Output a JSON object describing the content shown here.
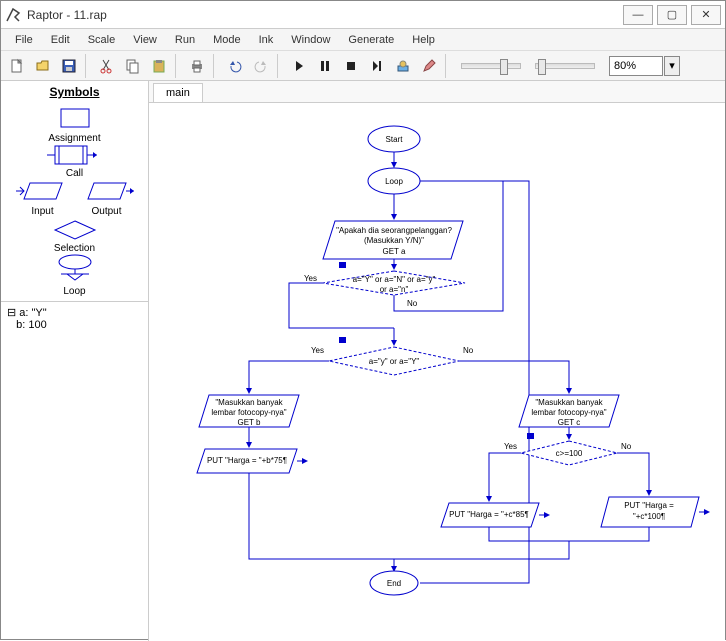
{
  "window": {
    "title": "Raptor - 11.rap",
    "min": "—",
    "max": "▢",
    "close": "✕"
  },
  "menu": [
    "File",
    "Edit",
    "Scale",
    "View",
    "Run",
    "Mode",
    "Ink",
    "Window",
    "Generate",
    "Help"
  ],
  "zoom": {
    "value": "80%"
  },
  "symbols": {
    "title": "Symbols",
    "assignment": "Assignment",
    "call": "Call",
    "input": "Input",
    "output": "Output",
    "selection": "Selection",
    "loop": "Loop"
  },
  "vars": {
    "a": "a: \"Y\"",
    "b": "b: 100"
  },
  "tab": {
    "main": "main"
  },
  "flow": {
    "start": "Start",
    "loop": "Loop",
    "end": "End",
    "yes": "Yes",
    "no": "No",
    "inputQ1a": "\"Apakah dia seorangpelanggan?",
    "inputQ1b": "(Masukkan Y/N)\"",
    "inputQ1c": "GET a",
    "cond1a": "a=\"Y\" or a=\"N\" or a=\"y\"",
    "cond1b": "or a=\"n\"",
    "cond2": "a=\"y\" or a=\"Y\"",
    "inL1": "\"Masukkan banyak",
    "inL2": "lembar fotocopy-nya\"",
    "inLb": "GET b",
    "inLc": "GET c",
    "cond3": "c>=100",
    "out75": "PUT \"Harga = \"+b*75¶",
    "out85": "PUT \"Harga = \"+c*85¶",
    "out100a": "PUT \"Harga =",
    "out100b": "\"+c*100¶"
  }
}
